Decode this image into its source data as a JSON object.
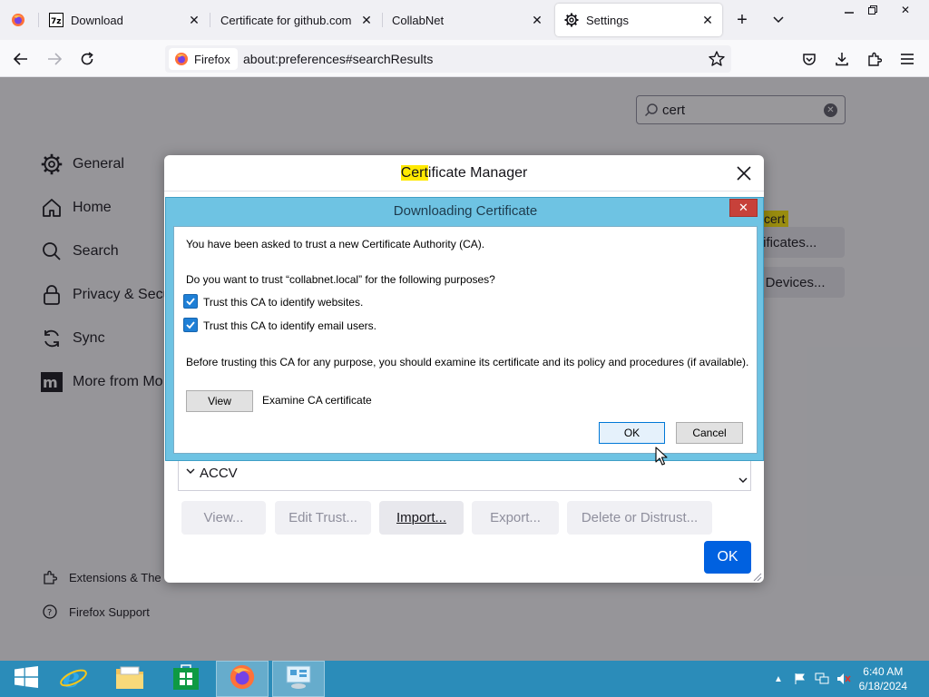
{
  "tabs": [
    {
      "label": "Download",
      "favicon": "7zip-icon"
    },
    {
      "label": "Certificate for github.com",
      "favicon": "none"
    },
    {
      "label": "CollabNet",
      "favicon": "none"
    },
    {
      "label": "Settings",
      "favicon": "gear-icon",
      "active": true
    }
  ],
  "urlbar": {
    "identity": "Firefox",
    "url": "about:preferences#searchResults"
  },
  "search": {
    "value": "cert"
  },
  "sidebar": {
    "items": [
      {
        "label": "General",
        "icon": "gear-icon"
      },
      {
        "label": "Home",
        "icon": "home-icon"
      },
      {
        "label": "Search",
        "icon": "search-icon"
      },
      {
        "label": "Privacy & Secu",
        "icon": "lock-icon"
      },
      {
        "label": "Sync",
        "icon": "sync-icon"
      },
      {
        "label": "More from Mo",
        "icon": "mozilla-icon"
      }
    ],
    "footer": [
      {
        "label": "Extensions & The",
        "icon": "puzzle-icon"
      },
      {
        "label": "Firefox Support",
        "icon": "help-icon"
      }
    ]
  },
  "background": {
    "highlight_tag": "cert",
    "view_certificates": "rtificates...",
    "security_devices": "y Devices..."
  },
  "cert_manager": {
    "title_highlight": "Cert",
    "title_rest": "ificate Manager",
    "tree_row": "ACCV",
    "buttons": {
      "view": "View...",
      "edit_trust": "Edit Trust...",
      "import": "Import...",
      "export": "Export...",
      "delete": "Delete or Distrust..."
    },
    "ok": "OK"
  },
  "download_dialog": {
    "title": "Downloading Certificate",
    "close": "✕",
    "intro": "You have been asked to trust a new Certificate Authority (CA).",
    "question": "Do you want to trust “collabnet.local” for the following purposes?",
    "check_websites": "Trust this CA to identify websites.",
    "check_email": "Trust this CA to identify email users.",
    "check_websites_checked": true,
    "check_email_checked": true,
    "note": "Before trusting this CA for any purpose, you should examine its certificate and its policy and procedures (if available).",
    "view_button": "View",
    "view_label": "Examine CA certificate",
    "ok": "OK",
    "cancel": "Cancel"
  },
  "taskbar": {
    "time": "6:40 AM",
    "date": "6/18/2024"
  }
}
